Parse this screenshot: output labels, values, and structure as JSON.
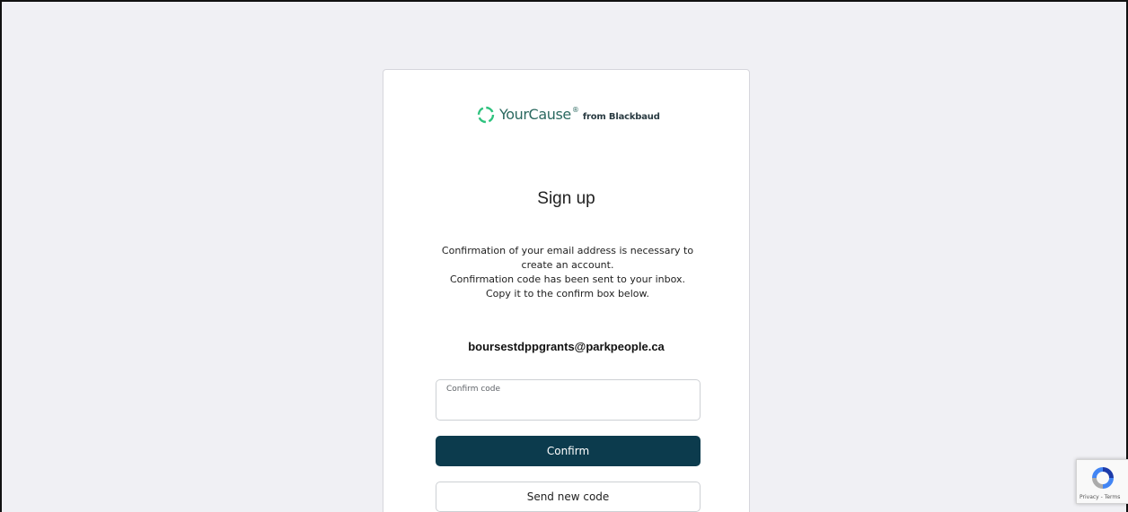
{
  "colors": {
    "page_background": "#f0f0f4",
    "brand_green": "#2ec27e",
    "brand_text": "#2b6960",
    "primary_button": "#0c3b4d"
  },
  "logo": {
    "wordmark": "YourCause",
    "registered": "®",
    "suffix": "from Blackbaud",
    "icon": "ring-logo-icon"
  },
  "signup": {
    "title": "Sign up",
    "message_lines": [
      "Confirmation of your email address is necessary to",
      "create an account.",
      "Confirmation code has been sent to your inbox.",
      "Copy it to the confirm box below."
    ],
    "email": "boursestdppgrants@parkpeople.ca",
    "confirm_field": {
      "label": "Confirm code",
      "value": ""
    },
    "confirm_button": "Confirm",
    "resend_button": "Send new code"
  },
  "recaptcha": {
    "icon": "recaptcha-icon",
    "privacy": "Privacy",
    "separator": " - ",
    "terms": "Terms"
  }
}
